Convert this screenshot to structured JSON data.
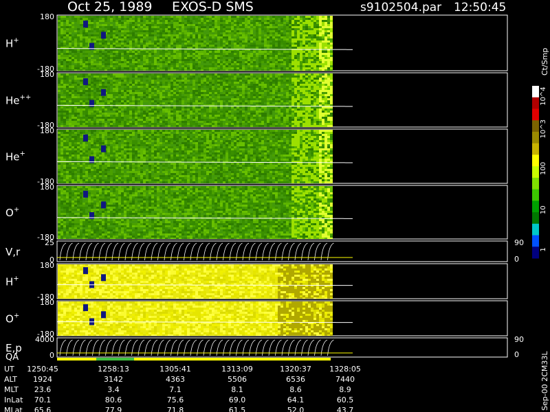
{
  "header": {
    "date": "Oct 25, 1989",
    "mission": "EXOS-D SMS",
    "file": "s9102504.par",
    "time": "12:50:45"
  },
  "colorbar": {
    "unit": "Ct/Smp",
    "tick_labels": [
      "10^4",
      "10^3",
      "100",
      "10",
      "1"
    ],
    "colors": [
      "#ffffff",
      "#b00000",
      "#e00000",
      "#7a6200",
      "#9a8a00",
      "#c8b400",
      "#ffff00",
      "#c8ff00",
      "#7fe000",
      "#3cc800",
      "#00a000",
      "#007800",
      "#00c8c8",
      "#0050ff",
      "#000080"
    ]
  },
  "footer": {
    "right_note": "Sep-00 2CM33L",
    "row_labels": [
      "UT",
      "ALT",
      "MLT",
      "InLat",
      "MLat"
    ],
    "columns": [
      [
        "1250:45",
        "1924",
        "23.6",
        "70.1",
        "65.6"
      ],
      [
        "1258:13",
        "3142",
        "3.4",
        "80.6",
        "77.9"
      ],
      [
        "1305:41",
        "4363",
        "7.1",
        "75.6",
        "71.8"
      ],
      [
        "1313:09",
        "5506",
        "8.1",
        "69.0",
        "61.5"
      ],
      [
        "1320:37",
        "6536",
        "8.6",
        "64.1",
        "52.0"
      ],
      [
        "1328:05",
        "7440",
        "8.9",
        "60.5",
        "43.7"
      ]
    ]
  },
  "chart_data": {
    "type": "heatmap",
    "title": "Oct 25, 1989   EXOS-D SMS",
    "x_ticks": [
      "1250:45",
      "1258:13",
      "1305:41",
      "1313:09",
      "1320:37",
      "1328:05"
    ],
    "panels": [
      {
        "label": "H",
        "sup": "+",
        "ymax": "180",
        "ymin": "-180",
        "palette": "green"
      },
      {
        "label": "He",
        "sup": "++",
        "ymax": "180",
        "ymin": "-180",
        "palette": "green"
      },
      {
        "label": "He",
        "sup": "+",
        "ymax": "180",
        "ymin": "-180",
        "palette": "green"
      },
      {
        "label": "O",
        "sup": "+",
        "ymax": "180",
        "ymin": "-180",
        "palette": "green"
      },
      {
        "label": "V,r",
        "sup": "",
        "ymax": "25",
        "ymin": "0",
        "palette": "line",
        "right_top": "90",
        "right_bottom": "0"
      },
      {
        "label": "H",
        "sup": "+",
        "ymax": "180",
        "ymin": "-180",
        "palette": "yellow"
      },
      {
        "label": "O",
        "sup": "+",
        "ymax": "180",
        "ymin": "-180",
        "palette": "yellow"
      },
      {
        "label": "E,p",
        "sup": "",
        "ymax": "4000",
        "ymin": "0",
        "palette": "line",
        "right_top": "90",
        "right_bottom": "0"
      }
    ],
    "qa_label": "QA"
  }
}
